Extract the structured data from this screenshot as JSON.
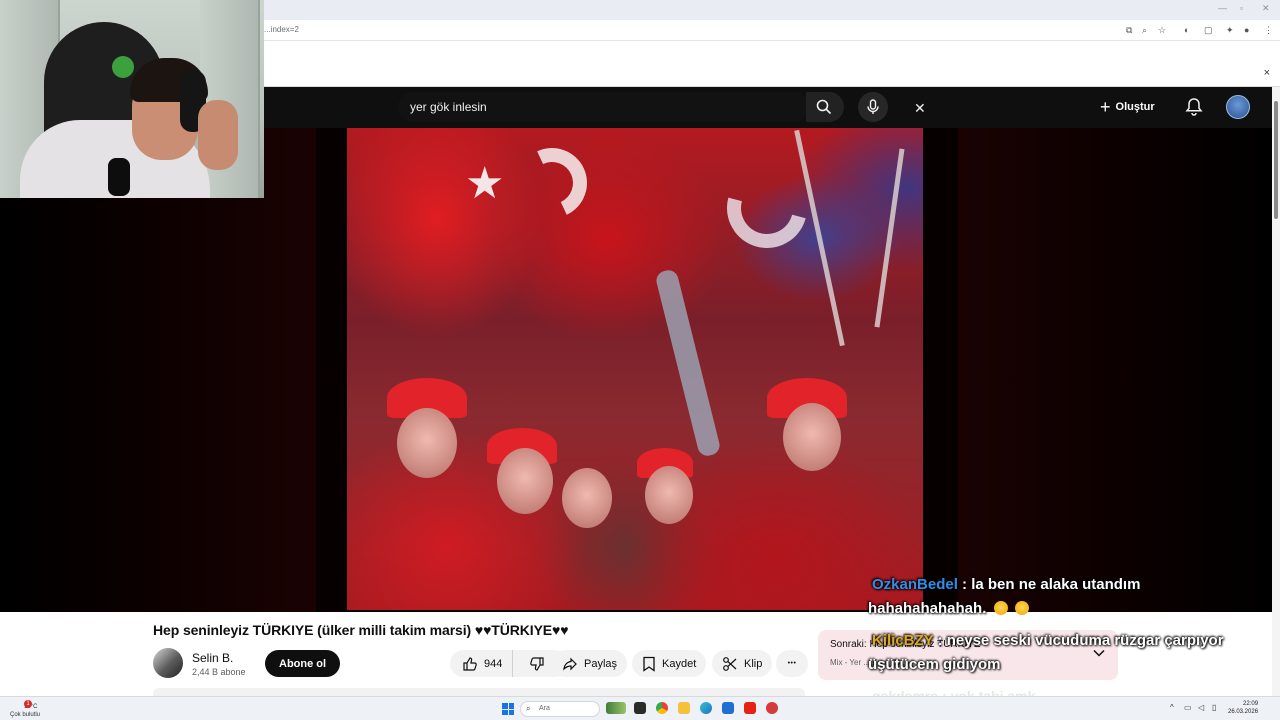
{
  "browser": {
    "url": "...index=2",
    "close_glyph": "×"
  },
  "youtube": {
    "search": {
      "value": "yer gök inlesin",
      "clear_glyph": "✕"
    },
    "create_label": "Oluştur",
    "create_glyph": "+"
  },
  "video": {
    "title": "Hep seninleyiz TÜRKIYE (ülker milli takim marsi) ♥♥TÜRKIYE♥♥",
    "channel": {
      "name": "Selin B.",
      "subscribers": "2,44 B abone"
    },
    "subscribe_label": "Abone ol",
    "likes": "944",
    "share_label": "Paylaş",
    "save_label": "Kaydet",
    "clip_label": "Klip",
    "more_glyph": "•••"
  },
  "up_next": {
    "label": "Sonraki: Hep seninleyiz TÜRKIYE",
    "subtitle": "Mix - Yer ... Euro 2016"
  },
  "chat": [
    {
      "user": "OzkanBedel",
      "message": ": la ben ne alaka utandım"
    },
    {
      "user": "",
      "message": "hahahahahahah."
    },
    {
      "user": "KilicBZY",
      "message": ": neyse seski vücuduma rüzgar çarpıyor"
    },
    {
      "user": "",
      "message": "üşütücem gidiyom"
    },
    {
      "user": "",
      "message": "gekdemre : yok tabi amk"
    }
  ],
  "taskbar": {
    "weather_temp": "10°C",
    "weather_desc": "Çok bulutlu",
    "weather_badge": "1",
    "search_label": "Ara",
    "time": "22:09",
    "date": "26.03.2026"
  },
  "colors": {
    "chat_user_1": "#2f8fe8",
    "chat_user_2": "#e0a81a",
    "youtube_dark": "#0f0f0f",
    "next_card_bg": "#f9e6ea"
  },
  "icons": [
    "search-icon",
    "microphone-icon",
    "bell-icon",
    "like-icon",
    "dislike-icon",
    "share-icon",
    "save-icon",
    "clip-icon",
    "chevron-down-icon",
    "windows-start-icon"
  ]
}
